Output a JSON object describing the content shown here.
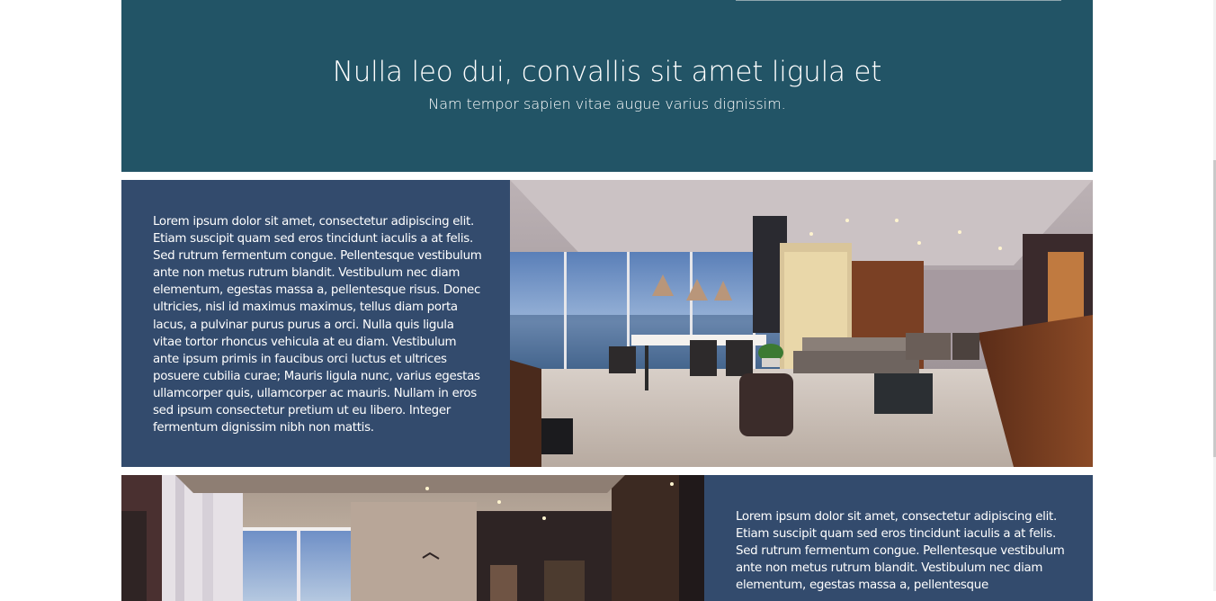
{
  "hero": {
    "title": "Nulla leo dui, convallis sit amet ligula et",
    "subtitle": "Nam tempor sapien vitae augue varius dignissim."
  },
  "sections": [
    {
      "text": "Lorem ipsum dolor sit amet, consectetur adipiscing elit. Etiam suscipit quam sed eros tincidunt iaculis a at felis. Sed rutrum fermentum congue. Pellentesque vestibulum ante non metus rutrum blandit. Vestibulum nec diam elementum, egestas massa a, pellentesque risus. Donec ultricies, nisl id maximus maximus, tellus diam porta lacus, a pulvinar purus purus a orci. Nulla quis ligula vitae tortor rhoncus vehicula at eu diam. Vestibulum ante ipsum primis in faucibus orci luctus et ultrices posuere cubilia curae; Mauris ligula nunc, varius egestas ullamcorper quis, ullamcorper ac mauris. Nullam in eros sed ipsum consectetur pretium ut eu libero. Integer fermentum dignissim nibh non mattis.",
      "image": "living-room-render"
    },
    {
      "text": "Lorem ipsum dolor sit amet, consectetur adipiscing elit. Etiam suscipit quam sed eros tincidunt iaculis a at felis. Sed rutrum fermentum congue. Pellentesque vestibulum ante non metus rutrum blandit. Vestibulum nec diam elementum, egestas massa a, pellentesque",
      "image": "lounge-interior-render"
    }
  ],
  "colors": {
    "hero_bg": "#225466",
    "panel_bg": "#334b6d",
    "text": "#ffffff"
  }
}
